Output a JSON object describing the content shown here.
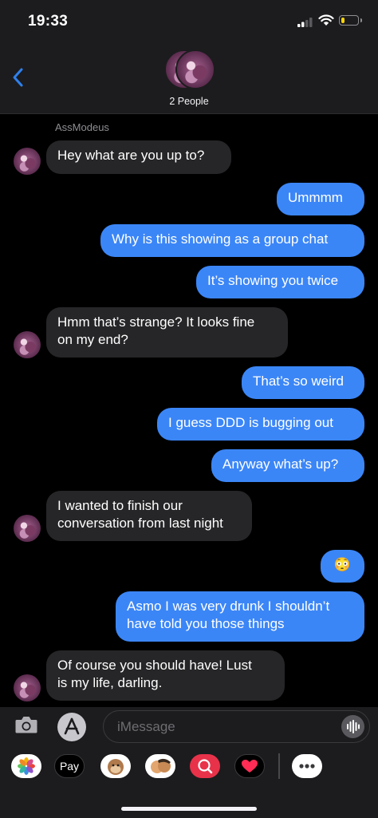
{
  "status_bar": {
    "time": "19:33",
    "battery_level": 0.22
  },
  "header": {
    "subtitle": "2 People"
  },
  "sender_name": "AssModeus",
  "messages": [
    {
      "direction": "incoming",
      "text": "Hey what are you up to?"
    },
    {
      "direction": "outgoing",
      "text": "Ummmm"
    },
    {
      "direction": "outgoing",
      "text": "Why is this showing as a group chat"
    },
    {
      "direction": "outgoing",
      "text": "It’s showing you twice"
    },
    {
      "direction": "incoming",
      "line1": "Hmm that’s strange? It looks fine",
      "line2": "on my end?"
    },
    {
      "direction": "outgoing",
      "text": "That’s so weird"
    },
    {
      "direction": "outgoing",
      "text": "I guess DDD is bugging out"
    },
    {
      "direction": "outgoing",
      "text": "Anyway what’s up?"
    },
    {
      "direction": "incoming",
      "line1": "I wanted to finish our",
      "line2": "conversation from last night"
    },
    {
      "direction": "outgoing",
      "text": "😳"
    },
    {
      "direction": "outgoing",
      "line1": "Asmo I was very drunk I shouldn’t",
      "line2": "have told you those things"
    },
    {
      "direction": "incoming",
      "line1": "Of course you should have! Lust",
      "line2": "is my life, darling."
    }
  ],
  "composer": {
    "placeholder": "iMessage"
  },
  "app_tray": {
    "items": [
      {
        "name": "photos-app-icon"
      },
      {
        "name": "apple-pay-icon",
        "label": "Pay"
      },
      {
        "name": "animoji-icon"
      },
      {
        "name": "memoji-icon"
      },
      {
        "name": "image-search-icon"
      },
      {
        "name": "digital-touch-icon"
      },
      {
        "name": "more-apps-icon"
      }
    ]
  },
  "colors": {
    "outgoing_bubble": "#3b86f7",
    "incoming_bubble": "#262628",
    "back_chevron": "#2f80ed"
  }
}
